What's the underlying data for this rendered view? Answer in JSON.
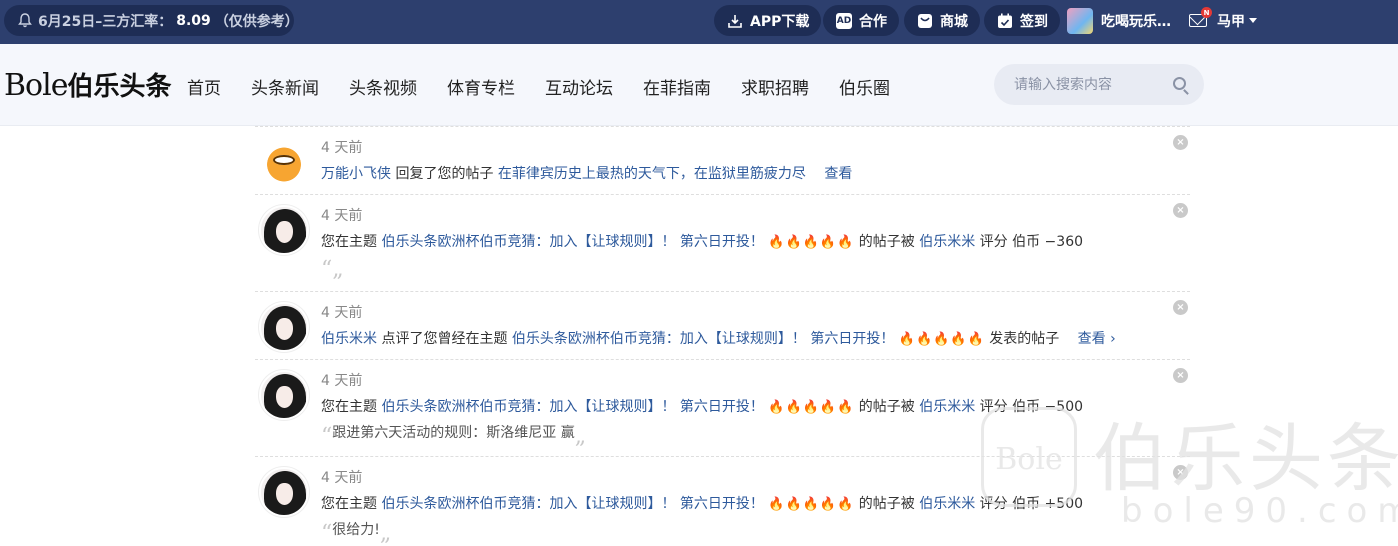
{
  "topbar": {
    "rate_prefix": "6月25日–三方汇率：",
    "rate_value": "8.09",
    "rate_suffix": "（仅供参考）",
    "links": [
      {
        "label": "APP下载",
        "icon": "download-icon"
      },
      {
        "label": "合作",
        "icon": "ad-icon",
        "icon_text": "AD"
      },
      {
        "label": "商城",
        "icon": "shop-icon"
      },
      {
        "label": "签到",
        "icon": "calendar-icon"
      }
    ],
    "user_group": "吃喝玩乐…",
    "mail_badge": "N",
    "username": "马甲"
  },
  "header": {
    "logo_en": "Bole",
    "logo_cn": "伯乐头条",
    "nav": [
      "首页",
      "头条新闻",
      "头条视频",
      "体育专栏",
      "互动论坛",
      "在菲指南",
      "求职招聘",
      "伯乐圈"
    ],
    "search_placeholder": "请输入搜索内容"
  },
  "notifications": [
    {
      "time": "4 天前",
      "avatar": "cat",
      "user": "万能小飞侠",
      "action": "回复了您的帖子",
      "thread": "在菲律宾历史上最热的天气下，在监狱里筋疲力尽",
      "view": "查看"
    },
    {
      "time": "4 天前",
      "avatar": "girl",
      "prefix": "您在主题",
      "thread": "伯乐头条欧洲杯伯币竞猜：加入【让球规则】！ 第六日开投！",
      "fire": "🔥🔥🔥🔥🔥",
      "mid": "的帖子被",
      "user": "伯乐米米",
      "rating": "评分 伯币 −360",
      "quote": ""
    },
    {
      "time": "4 天前",
      "avatar": "girl",
      "user": "伯乐米米",
      "action": "点评了您曾经在主题",
      "thread": "伯乐头条欧洲杯伯币竞猜：加入【让球规则】！ 第六日开投！",
      "fire": "🔥🔥🔥🔥🔥",
      "suffix": "发表的帖子",
      "view": "查看 ›"
    },
    {
      "time": "4 天前",
      "avatar": "girl",
      "prefix": "您在主题",
      "thread": "伯乐头条欧洲杯伯币竞猜：加入【让球规则】！ 第六日开投！",
      "fire": "🔥🔥🔥🔥🔥",
      "mid": "的帖子被",
      "user": "伯乐米米",
      "rating": "评分 伯币 −500",
      "quote": "跟进第六天活动的规则：斯洛维尼亚 赢"
    },
    {
      "time": "4 天前",
      "avatar": "girl",
      "prefix": "您在主题",
      "thread": "伯乐头条欧洲杯伯币竞猜：加入【让球规则】！ 第六日开投！",
      "fire": "🔥🔥🔥🔥🔥",
      "mid": "的帖子被",
      "user": "伯乐米米",
      "rating": "评分 伯币 +500",
      "quote": "很给力!"
    }
  ],
  "watermark": {
    "box": "Bole",
    "cn": "伯乐头条",
    "en": "bole90.com"
  },
  "colors": {
    "topbar_bg": "#2d3f6e",
    "pill_bg": "#1e2d55",
    "link": "#2e5a9c"
  }
}
